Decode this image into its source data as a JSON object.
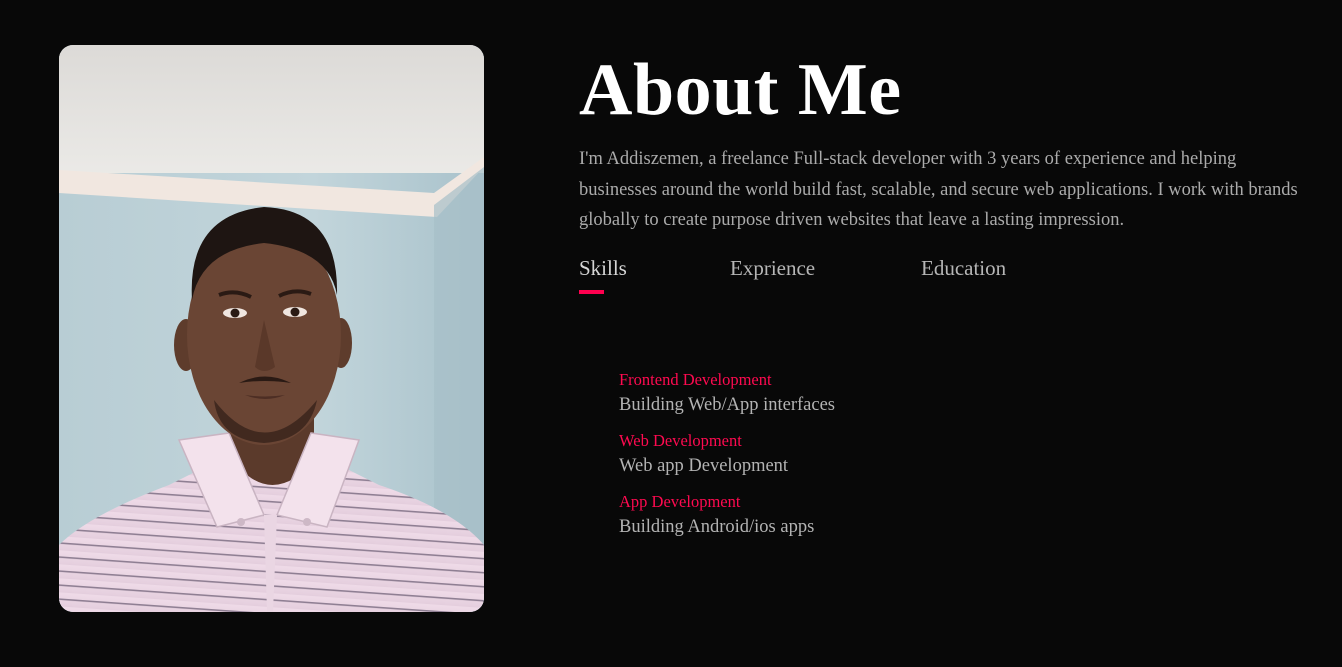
{
  "colors": {
    "background": "#080808",
    "accent": "#ff004f",
    "heading": "#ffffff",
    "body_text": "#ababab"
  },
  "about": {
    "title": "About Me",
    "intro": "I'm Addiszemen, a freelance Full-stack developer with 3 years of experience and helping businesses around the world build fast, scalable, and secure web applications. I work with brands globally to create purpose driven websites that leave a lasting impression."
  },
  "tabs": [
    {
      "label": "Skills",
      "active": true
    },
    {
      "label": "Exprience",
      "active": false
    },
    {
      "label": "Education",
      "active": false
    }
  ],
  "skills": [
    {
      "name": "Frontend Development",
      "desc": "Building Web/App interfaces"
    },
    {
      "name": "Web Development",
      "desc": "Web app Development"
    },
    {
      "name": "App Development",
      "desc": "Building Android/ios apps"
    }
  ]
}
